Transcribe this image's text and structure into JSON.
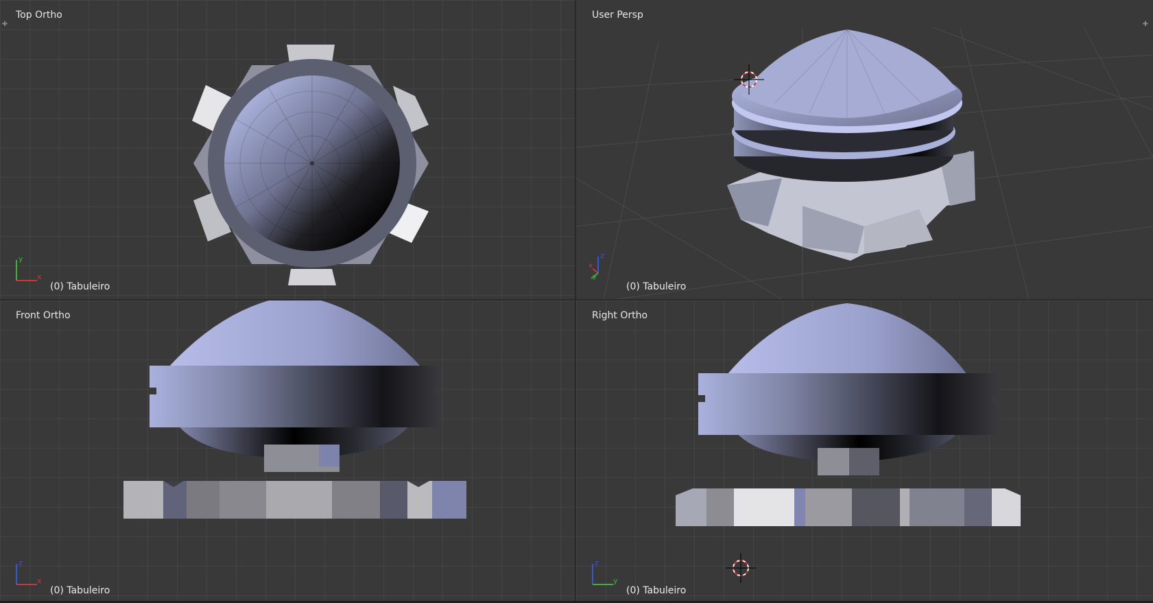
{
  "viewports": {
    "top": {
      "label": "Top Ortho",
      "object": "(0) Tabuleiro",
      "axes": [
        "y",
        "x"
      ]
    },
    "persp": {
      "label": "User Persp",
      "object": "(0) Tabuleiro",
      "axes": [
        "z",
        "x",
        "y"
      ]
    },
    "front": {
      "label": "Front Ortho",
      "object": "(0) Tabuleiro",
      "axes": [
        "z",
        "x"
      ]
    },
    "right": {
      "label": "Right Ortho",
      "object": "(0) Tabuleiro",
      "axes": [
        "z",
        "y"
      ]
    }
  },
  "icons": {
    "corner_widget": "plus-icon",
    "cursor": "3d-cursor-icon",
    "axes": "axis-gizmo-icon"
  },
  "colors": {
    "viewport_bg": "#393939",
    "grid": "#444444",
    "axis_x": "#c23a3a",
    "axis_y": "#3bb33b",
    "axis_z": "#3a59c9",
    "mesh_light": "#aab1dc",
    "mesh_dark": "#0a0a0c"
  }
}
